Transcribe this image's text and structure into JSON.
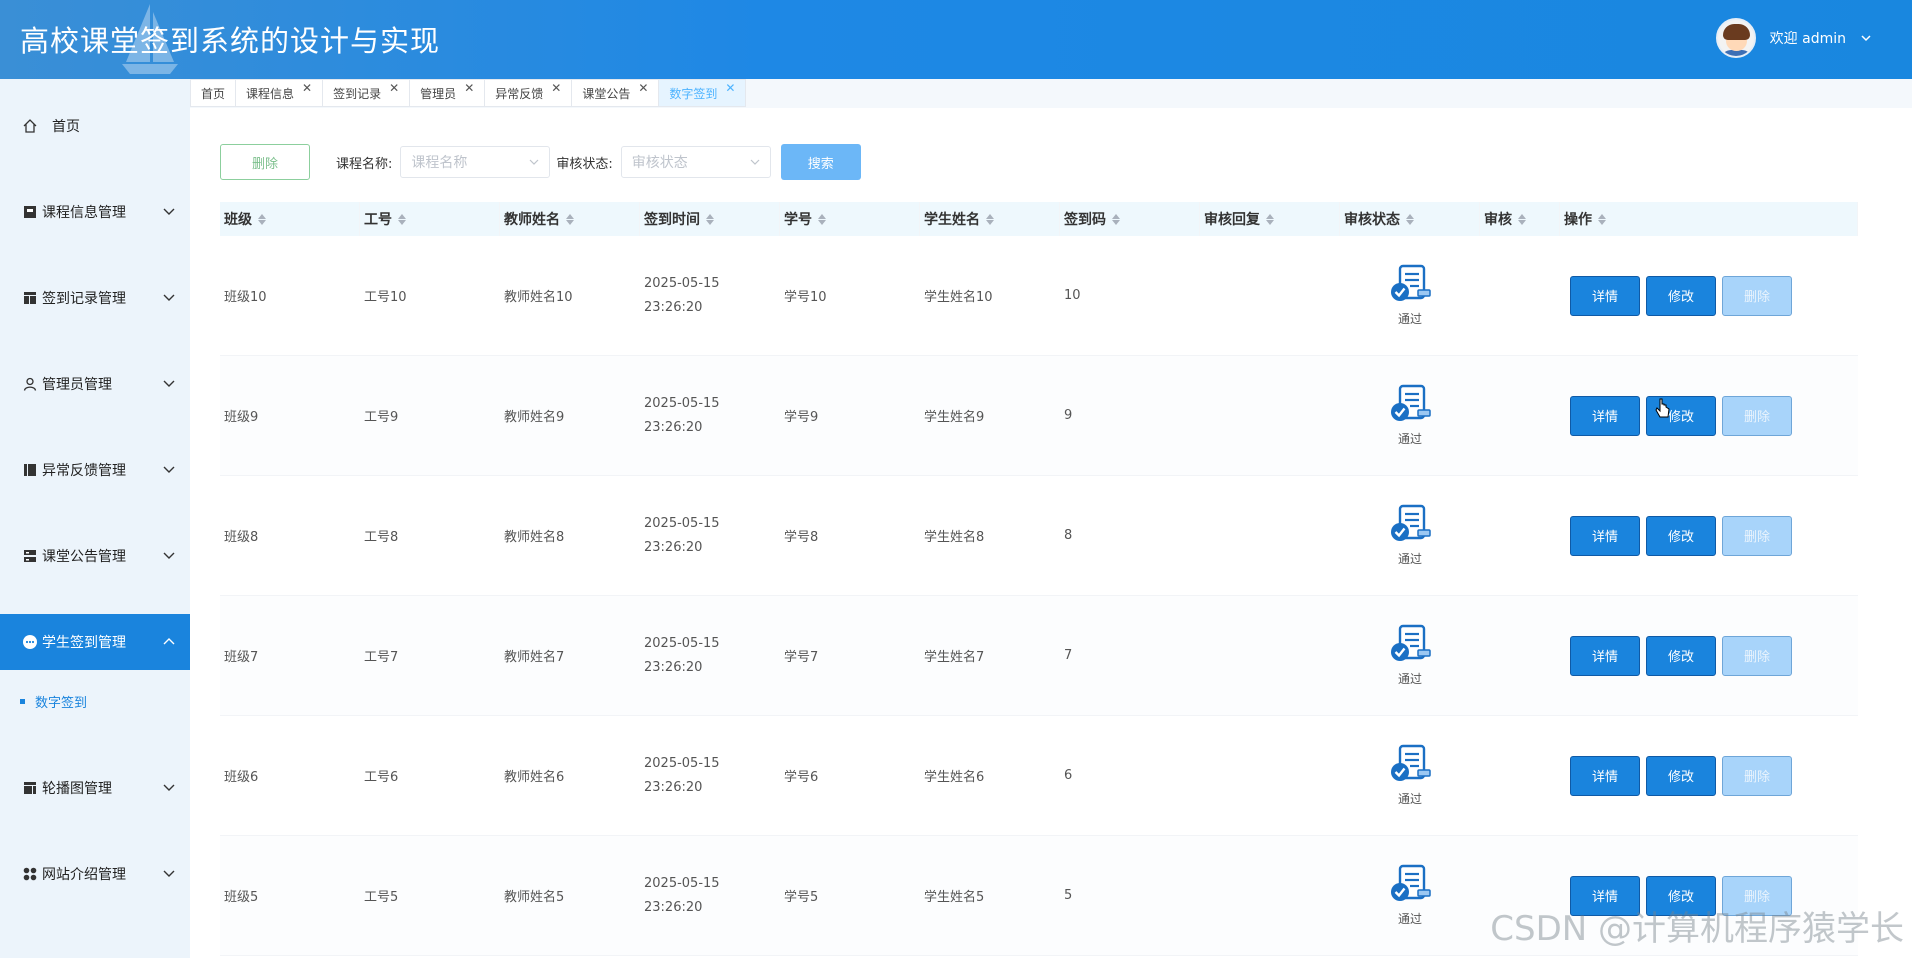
{
  "header": {
    "title": "高校课堂签到系统的设计与实现",
    "welcome": "欢迎 admin"
  },
  "sidebar": {
    "items": [
      {
        "label": "首页",
        "icon": "home-icon"
      },
      {
        "label": "课程信息管理",
        "icon": "book-icon"
      },
      {
        "label": "签到记录管理",
        "icon": "table-icon"
      },
      {
        "label": "管理员管理",
        "icon": "user-icon"
      },
      {
        "label": "异常反馈管理",
        "icon": "columns-icon"
      },
      {
        "label": "课堂公告管理",
        "icon": "server-icon"
      },
      {
        "label": "学生签到管理",
        "icon": "chat-icon"
      },
      {
        "label": "轮播图管理",
        "icon": "image-icon"
      },
      {
        "label": "网站介绍管理",
        "icon": "grid-icon"
      }
    ],
    "sub_item": "数字签到"
  },
  "tabs": [
    "首页",
    "课程信息",
    "签到记录",
    "管理员",
    "异常反馈",
    "课堂公告",
    "数字签到"
  ],
  "toolbar": {
    "delete_label": "删除",
    "course_label": "课程名称:",
    "course_placeholder": "课程名称",
    "status_label": "审核状态:",
    "status_placeholder": "审核状态",
    "search_label": "搜索"
  },
  "table": {
    "columns": [
      "班级",
      "工号",
      "教师姓名",
      "签到时间",
      "学号",
      "学生姓名",
      "签到码",
      "审核回复",
      "审核状态",
      "审核",
      "操作"
    ],
    "rows": [
      {
        "class": "班级10",
        "staff_no": "工号10",
        "teacher": "教师姓名10",
        "time": "2025-05-15 23:26:20",
        "student_no": "学号10",
        "student": "学生姓名10",
        "code": "10",
        "reply": "",
        "status": "通过"
      },
      {
        "class": "班级9",
        "staff_no": "工号9",
        "teacher": "教师姓名9",
        "time": "2025-05-15 23:26:20",
        "student_no": "学号9",
        "student": "学生姓名9",
        "code": "9",
        "reply": "",
        "status": "通过"
      },
      {
        "class": "班级8",
        "staff_no": "工号8",
        "teacher": "教师姓名8",
        "time": "2025-05-15 23:26:20",
        "student_no": "学号8",
        "student": "学生姓名8",
        "code": "8",
        "reply": "",
        "status": "通过"
      },
      {
        "class": "班级7",
        "staff_no": "工号7",
        "teacher": "教师姓名7",
        "time": "2025-05-15 23:26:20",
        "student_no": "学号7",
        "student": "学生姓名7",
        "code": "7",
        "reply": "",
        "status": "通过"
      },
      {
        "class": "班级6",
        "staff_no": "工号6",
        "teacher": "教师姓名6",
        "time": "2025-05-15 23:26:20",
        "student_no": "学号6",
        "student": "学生姓名6",
        "code": "6",
        "reply": "",
        "status": "通过"
      },
      {
        "class": "班级5",
        "staff_no": "工号5",
        "teacher": "教师姓名5",
        "time": "2025-05-15 23:26:20",
        "student_no": "学号5",
        "student": "学生姓名5",
        "code": "5",
        "reply": "",
        "status": "通过"
      }
    ],
    "actions": {
      "detail": "详情",
      "edit": "修改",
      "delete": "删除"
    }
  },
  "watermark": "CSDN @计算机程序猿学长",
  "colors": {
    "primary": "#1a84dd",
    "header": "#1e88e5",
    "active_tab": "#4db3ff"
  }
}
